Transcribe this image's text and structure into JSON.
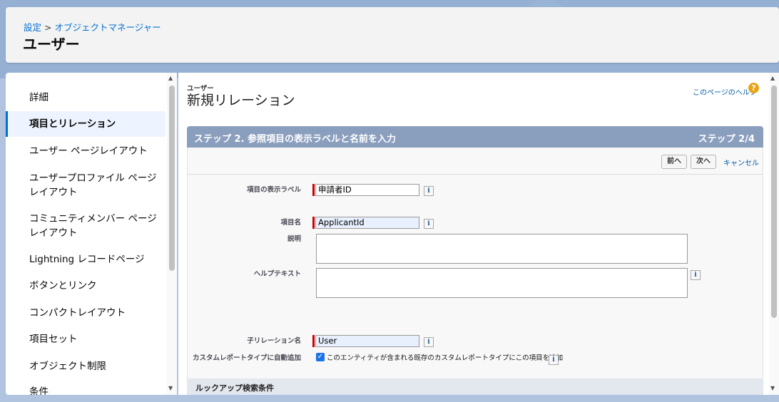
{
  "header": {
    "breadcrumb_root": "設定",
    "breadcrumb_sep": ">",
    "breadcrumb_child": "オブジェクトマネージャー",
    "title": "ユーザー"
  },
  "sidebar": {
    "items": [
      {
        "label": "詳細"
      },
      {
        "label": "項目とリレーション",
        "active": true
      },
      {
        "label": "ユーザー ページレイアウト"
      },
      {
        "label": "ユーザープロファイル ページレイアウト"
      },
      {
        "label": "コミュニティメンバー ページレイアウト"
      },
      {
        "label": "Lightning レコードページ"
      },
      {
        "label": "ボタンとリンク"
      },
      {
        "label": "コンパクトレイアウト"
      },
      {
        "label": "項目セット"
      },
      {
        "label": "オブジェクト制限"
      },
      {
        "label": "条件"
      }
    ]
  },
  "main": {
    "object_label": "ユーザー",
    "wizard_title": "新規リレーション",
    "help_link": "このページのヘルプ",
    "help_icon": "?",
    "step_title": "ステップ 2. 参照項目の表示ラベルと名前を入力",
    "step_counter": "ステップ 2/4",
    "buttons": {
      "prev": "前へ",
      "next": "次へ",
      "cancel": "キャンセル"
    },
    "fields": {
      "label_label": "項目の表示ラベル",
      "label_value": "申請者ID",
      "name_label": "項目名",
      "name_value": "ApplicantId",
      "desc_label": "説明",
      "help_text_label": "ヘルプテキスト",
      "child_rel_label": "子リレーション名",
      "child_rel_value": "User",
      "auto_add_label": "カスタムレポートタイプに自動追加",
      "auto_add_checkbox_label": "このエンティティが含まれる既存のカスタムレポートタイプにこの項目を追加",
      "auto_add_checked": true
    },
    "info_icon": "i",
    "section_lookup": "ルックアップ検索条件"
  },
  "colors": {
    "accent": "#0070d2",
    "step_bar": "#8a9ebe",
    "required": "#cc0000"
  }
}
